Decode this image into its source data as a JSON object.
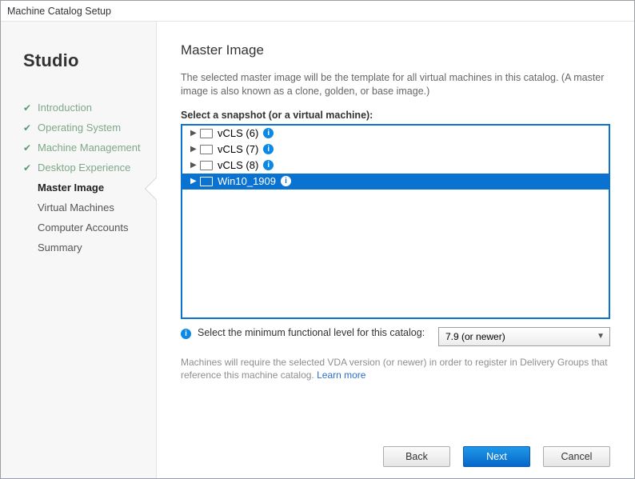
{
  "window": {
    "title": "Machine Catalog Setup"
  },
  "studio": "Studio",
  "steps": [
    {
      "label": "Introduction",
      "state": "done"
    },
    {
      "label": "Operating System",
      "state": "done"
    },
    {
      "label": "Machine Management",
      "state": "done"
    },
    {
      "label": "Desktop Experience",
      "state": "done"
    },
    {
      "label": "Master Image",
      "state": "current"
    },
    {
      "label": "Virtual Machines",
      "state": "todo"
    },
    {
      "label": "Computer Accounts",
      "state": "todo"
    },
    {
      "label": "Summary",
      "state": "todo"
    }
  ],
  "page": {
    "heading": "Master Image",
    "description": "The selected master image will be the template for all virtual machines in this catalog. (A master image is also known as a clone, golden, or base image.)",
    "snapshot_label": "Select a snapshot (or a virtual machine):"
  },
  "tree": [
    {
      "label": "vCLS (6)",
      "selected": false
    },
    {
      "label": "vCLS (7)",
      "selected": false
    },
    {
      "label": "vCLS (8)",
      "selected": false
    },
    {
      "label": "Win10_1909",
      "selected": true
    }
  ],
  "functional_level": {
    "text": "Select the minimum functional level for this catalog:",
    "selected": "7.9 (or newer)"
  },
  "note": {
    "text": "Machines will require the selected VDA version (or newer) in order to register in Delivery Groups that reference this machine catalog. ",
    "link": "Learn more"
  },
  "buttons": {
    "back": "Back",
    "next": "Next",
    "cancel": "Cancel"
  }
}
